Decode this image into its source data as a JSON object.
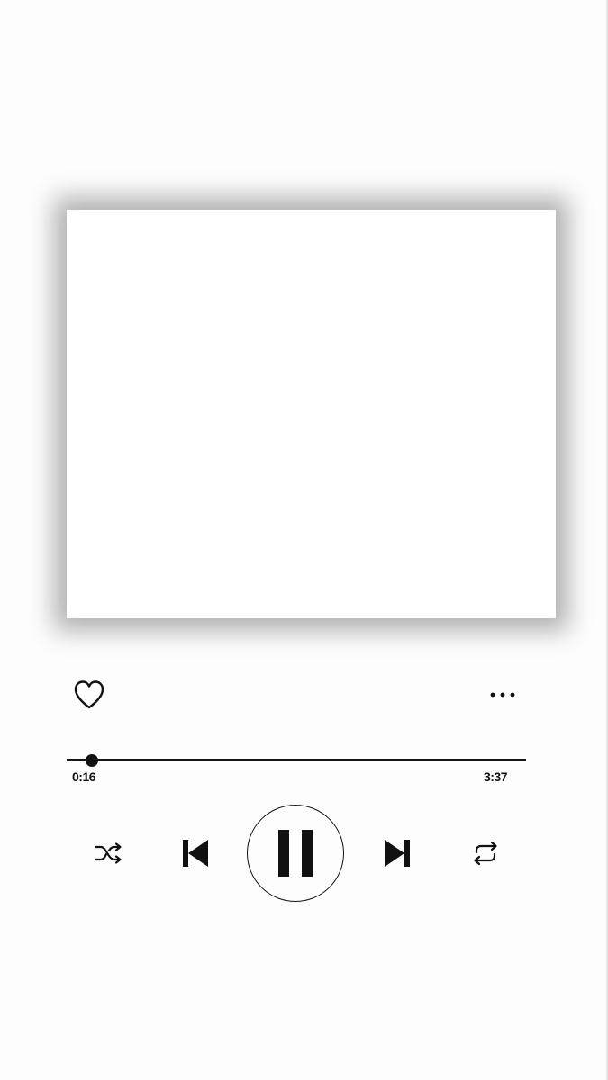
{
  "player": {
    "elapsed_time": "0:16",
    "total_time": "3:37",
    "progress_fraction": 0.054,
    "state": "playing",
    "liked": false
  },
  "icons": {
    "like": "heart-outline-icon",
    "more": "more-horizontal-icon",
    "shuffle": "shuffle-icon",
    "previous": "skip-previous-icon",
    "play_pause": "pause-icon",
    "next": "skip-next-icon",
    "repeat": "repeat-icon"
  },
  "colors": {
    "background": "#fdfdfd",
    "foreground": "#111111",
    "artwork": "#ffffff"
  }
}
